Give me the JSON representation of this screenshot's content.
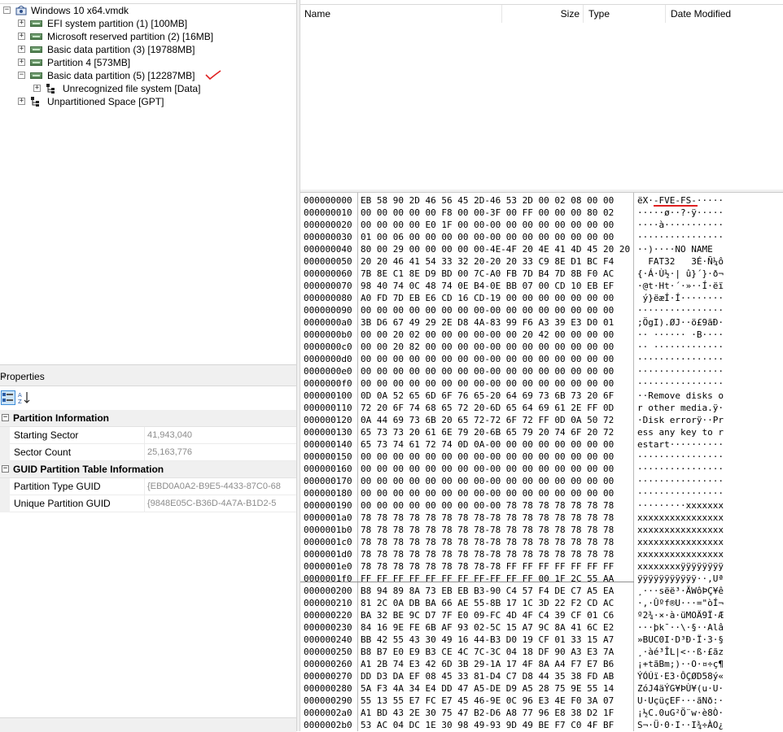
{
  "tree": {
    "root": "Windows 10 x64.vmdk",
    "partitions": [
      "EFI system partition (1) [100MB]",
      "Microsoft reserved partition (2) [16MB]",
      "Basic data partition (3) [19788MB]",
      "Partition 4 [573MB]",
      "Basic data partition (5) [12287MB]"
    ],
    "child": "Unrecognized file system [Data]",
    "unpartitioned": "Unpartitioned Space [GPT]"
  },
  "filelist": {
    "columns": {
      "name": "Name",
      "size": "Size",
      "type": "Type",
      "date": "Date Modified"
    }
  },
  "properties": {
    "title": "Properties",
    "close": "×",
    "categories": [
      {
        "label": "Partition Information",
        "rows": [
          {
            "name": "Starting Sector",
            "value": "41,943,040"
          },
          {
            "name": "Sector Count",
            "value": "25,163,776"
          }
        ]
      },
      {
        "label": "GUID Partition Table Information",
        "rows": [
          {
            "name": "Partition Type GUID",
            "value": "{EBD0A0A2-B9E5-4433-87C0-68"
          },
          {
            "name": "Unique Partition GUID",
            "value": "{9848E05C-B36D-4A7A-B1D2-5"
          }
        ]
      }
    ]
  },
  "hex": {
    "rows": [
      [
        "000000000",
        "EB 58 90 2D 46 56 45 2D-46 53 2D 00 02 08 00 00",
        "ëX·-FVE-FS-·····"
      ],
      [
        "000000010",
        "00 00 00 00 00 F8 00 00-3F 00 FF 00 00 00 80 02",
        "·····ø··?·ÿ·····"
      ],
      [
        "000000020",
        "00 00 00 00 E0 1F 00 00-00 00 00 00 00 00 00 00",
        "····à···········"
      ],
      [
        "000000030",
        "01 00 06 00 00 00 00 00-00 00 00 00 00 00 00 00",
        "················"
      ],
      [
        "000000040",
        "80 00 29 00 00 00 00 00-4E-4F 20 4E 41 4D 45 20 20",
        "··)····NO NAME  "
      ],
      [
        "000000050",
        "20 20 46 41 54 33 32 20-20 20 33 C9 8E D1 BC F4",
        "  FAT32   3É·Ñ¼ô"
      ],
      [
        "000000060",
        "7B 8E C1 8E D9 BD 00 7C-A0 FB 7D B4 7D 8B F0 AC",
        "{·Á·Ù½·| û}´}·ð¬"
      ],
      [
        "000000070",
        "98 40 74 0C 48 74 0E B4-0E BB 07 00 CD 10 EB EF",
        "·@t·Ht·´·»··Í·ëï"
      ],
      [
        "000000080",
        "A0 FD 7D EB E6 CD 16 CD-19 00 00 00 00 00 00 00",
        " ý}ëæÍ·Í········"
      ],
      [
        "000000090",
        "00 00 00 00 00 00 00 00-00 00 00 00 00 00 00 00",
        "················"
      ],
      [
        "0000000a0",
        "3B D6 67 49 29 2E D8 4A-83 99 F6 A3 39 E3 D0 01",
        ";ÖgI).ØJ··ö£9ãÐ·"
      ],
      [
        "0000000b0",
        "00 00 20 02 00 00 00 00-00 00 20 42 00 00 00 00",
        "·· ······ ·B····"
      ],
      [
        "0000000c0",
        "00 00 20 82 00 00 00 00-00 00 00 00 00 00 00 00",
        "·· ·············"
      ],
      [
        "0000000d0",
        "00 00 00 00 00 00 00 00-00 00 00 00 00 00 00 00",
        "················"
      ],
      [
        "0000000e0",
        "00 00 00 00 00 00 00 00-00 00 00 00 00 00 00 00",
        "················"
      ],
      [
        "0000000f0",
        "00 00 00 00 00 00 00 00-00 00 00 00 00 00 00 00",
        "················"
      ],
      [
        "000000100",
        "0D 0A 52 65 6D 6F 76 65-20 64 69 73 6B 73 20 6F",
        "··Remove disks o"
      ],
      [
        "000000110",
        "72 20 6F 74 68 65 72 20-6D 65 64 69 61 2E FF 0D",
        "r other media.ÿ·"
      ],
      [
        "000000120",
        "0A 44 69 73 6B 20 65 72-72 6F 72 FF 0D 0A 50 72",
        "·Disk errorÿ··Pr"
      ],
      [
        "000000130",
        "65 73 73 20 61 6E 79 20-6B 65 79 20 74 6F 20 72",
        "ess any key to r"
      ],
      [
        "000000140",
        "65 73 74 61 72 74 0D 0A-00 00 00 00 00 00 00 00",
        "estart··········"
      ],
      [
        "000000150",
        "00 00 00 00 00 00 00 00-00 00 00 00 00 00 00 00",
        "················"
      ],
      [
        "000000160",
        "00 00 00 00 00 00 00 00-00 00 00 00 00 00 00 00",
        "················"
      ],
      [
        "000000170",
        "00 00 00 00 00 00 00 00-00 00 00 00 00 00 00 00",
        "················"
      ],
      [
        "000000180",
        "00 00 00 00 00 00 00 00-00 00 00 00 00 00 00 00",
        "················"
      ],
      [
        "000000190",
        "00 00 00 00 00 00 00 00-00 78 78 78 78 78 78 78",
        "·········xxxxxxx"
      ],
      [
        "0000001a0",
        "78 78 78 78 78 78 78 78-78 78 78 78 78 78 78 78",
        "xxxxxxxxxxxxxxxx"
      ],
      [
        "0000001b0",
        "78 78 78 78 78 78 78 78-78 78 78 78 78 78 78 78",
        "xxxxxxxxxxxxxxxx"
      ],
      [
        "0000001c0",
        "78 78 78 78 78 78 78 78-78 78 78 78 78 78 78 78",
        "xxxxxxxxxxxxxxxx"
      ],
      [
        "0000001d0",
        "78 78 78 78 78 78 78 78-78 78 78 78 78 78 78 78",
        "xxxxxxxxxxxxxxxx"
      ],
      [
        "0000001e0",
        "78 78 78 78 78 78 78 78-78 FF FF FF FF FF FF FF",
        "xxxxxxxxÿÿÿÿÿÿÿÿ"
      ],
      [
        "0000001f0",
        "FF FF FF FF FF FF FF FF-FF FF FF 00 1F 2C 55 AA",
        "ÿÿÿÿÿÿÿÿÿÿÿ··,Uª"
      ],
      [
        "000000200",
        "B8 94 89 8A 73 EB EB B3-90 C4 57 F4 DE C7 A5 EA",
        "¸···sëë³·ÄWôÞÇ¥ê"
      ],
      [
        "000000210",
        "81 2C 0A DB BA 66 AE 55-8B 17 1C 3D 22 F2 CD AC",
        "·,·Ûºf®U···=\"òÍ¬"
      ],
      [
        "000000220",
        "BA 32 BE 9C D7 7F E0 09-FC 4D 4F C4 39 CF 01 C6",
        "º2¾·×·à·üMOÄ9Ï·Æ"
      ],
      [
        "000000230",
        "84 16 9E FE 6B AF 93 02-5C 15 A7 9C 8A 41 6C E2",
        "···þk¯··\\·§··Alâ"
      ],
      [
        "000000240",
        "BB 42 55 43 30 49 16 44-B3 D0 19 CF 01 33 15 A7",
        "»BUC0I·D³Ð·Ï·3·§"
      ],
      [
        "000000250",
        "B8 B7 E0 E9 B3 CE 4C 7C-3C 04 18 DF 90 A3 E3 7A",
        "¸·àé³ÎL|<··ß·£ãz"
      ],
      [
        "000000260",
        "A1 2B 74 E3 42 6D 3B 29-1A 17 4F 8A A4 F7 E7 B6",
        "¡+tãBm;)··O·¤÷ç¶"
      ],
      [
        "000000270",
        "DD D3 DA EF 08 45 33 81-D4 C7 D8 44 35 38 FD AB",
        "ÝÓÚï·E3·ÔÇØD58ý«"
      ],
      [
        "000000280",
        "5A F3 4A 34 E4 DD 47 A5-DE D9 A5 28 75 9E 55 14",
        "ZóJ4äÝG¥ÞÙ¥(u·U·"
      ],
      [
        "000000290",
        "55 13 55 E7 FC E7 45 46-9E 0C 96 E3 4E F0 3A 07",
        "U·UçüçEF···ãNð:·"
      ],
      [
        "0000002a0",
        "A1 BD 43 2E 30 75 47 B2-D6 A8 77 96 E8 38 D2 1F",
        "¡½C.0uG²Ö¨w·è8Ò·"
      ],
      [
        "0000002b0",
        "53 AC 04 DC 1E 30 98 49-93 9D 49 BE F7 C0 4F BF",
        "S¬·Ü·0·I··I¾÷ÀO¿"
      ]
    ]
  },
  "colors": {
    "accent": "#3c8cd8",
    "highlight": "#e02020"
  }
}
